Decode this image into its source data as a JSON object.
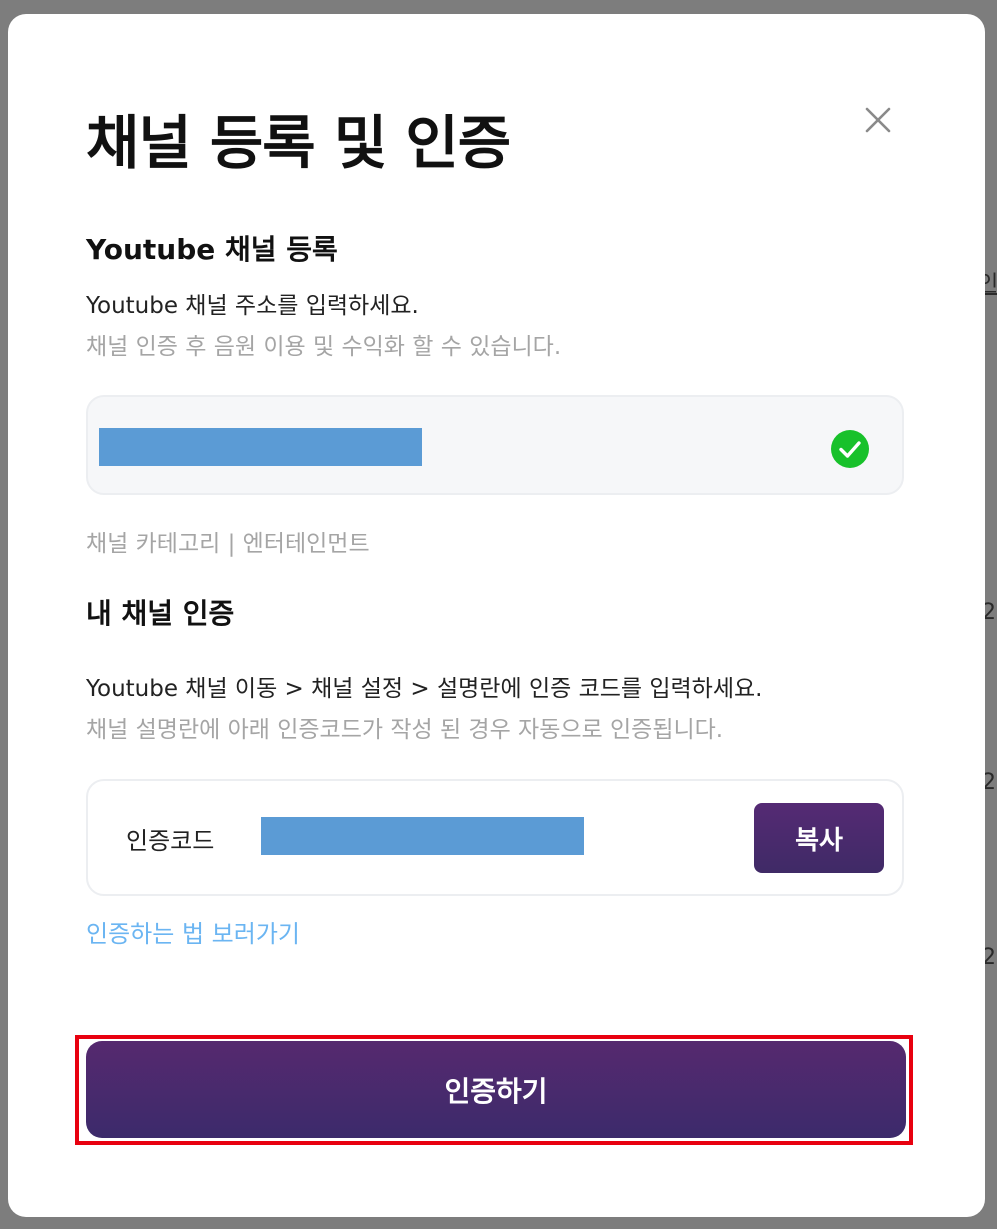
{
  "modal": {
    "title": "채널 등록 및 인증",
    "close_icon": "close-icon"
  },
  "register": {
    "heading": "Youtube 채널 등록",
    "description": "Youtube 채널 주소를 입력하세요.",
    "subtext": "채널 인증 후 음원 이용 및 수익화 할 수 있습니다.",
    "status_icon": "check-circle-icon",
    "status_color": "#18c12b",
    "category": "채널 카테고리 | 엔터테인먼트"
  },
  "verify": {
    "heading": "내 채널 인증",
    "description": "Youtube 채널 이동 > 채널 설정 > 설명란에 인증 코드를 입력하세요.",
    "subtext": "채널 설명란에 아래 인증코드가 작성 된 경우 자동으로 인증됩니다.",
    "code_label": "인증코드",
    "copy_label": "복사",
    "guide_link": "인증하는 법 보러가기"
  },
  "submit": {
    "label": "인증하기"
  },
  "colors": {
    "accent": "#4a2a6e",
    "link": "#6bb5f2",
    "highlight": "#e8000f"
  },
  "background": {
    "fragments": [
      "인",
      "2",
      "2",
      "2"
    ]
  }
}
